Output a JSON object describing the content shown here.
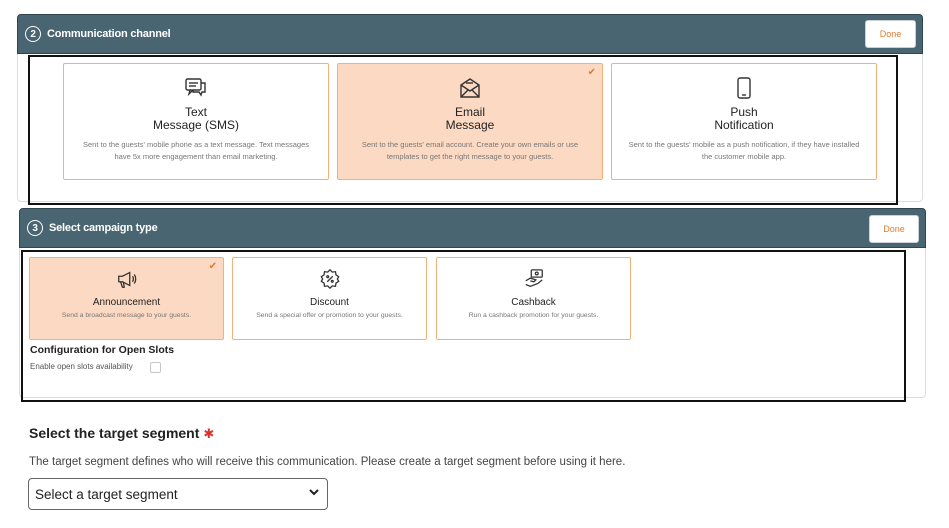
{
  "channel_section": {
    "step": "2",
    "title": "Communication channel",
    "done_label": "Done",
    "cards": [
      {
        "title": "Text\nMessage (SMS)",
        "desc": "Sent to the guests' mobile phone as a text message. Text messages have 5x more engagement than email marketing.",
        "icon": "chat-bubbles-icon",
        "selected": false
      },
      {
        "title": "Email\nMessage",
        "desc": "Sent to the guests' email account. Create your own emails or use templates to get the right message to your guests.",
        "icon": "envelope-icon",
        "selected": true
      },
      {
        "title": "Push\nNotification",
        "desc": "Sent to the guests' mobile as a push notification, if they have installed the customer mobile app.",
        "icon": "mobile-phone-icon",
        "selected": false
      }
    ]
  },
  "campaign_section": {
    "step": "3",
    "title": "Select campaign type",
    "done_label": "Done",
    "cards": [
      {
        "title": "Announcement",
        "desc": "Send a broadcast message to your guests.",
        "icon": "megaphone-icon",
        "selected": true
      },
      {
        "title": "Discount",
        "desc": "Send a special offer or promotion to your guests.",
        "icon": "discount-badge-icon",
        "selected": false
      },
      {
        "title": "Cashback",
        "desc": "Run a cashback promotion for your guests.",
        "icon": "cashback-hand-icon",
        "selected": false
      }
    ],
    "config_title": "Configuration for Open Slots",
    "config_label": "Enable open slots availability"
  },
  "segment": {
    "title": "Select the target segment",
    "required_mark": "✱",
    "description": "The target segment defines who will receive this communication. Please create a target segment before using it here.",
    "select_value": "Select a target segment"
  },
  "colors": {
    "header_bg": "#4a6572",
    "accent": "#e07b2e",
    "selected_card_bg": "#fcd9c2",
    "card_border": "#f0b27a",
    "required": "#d9342b"
  }
}
